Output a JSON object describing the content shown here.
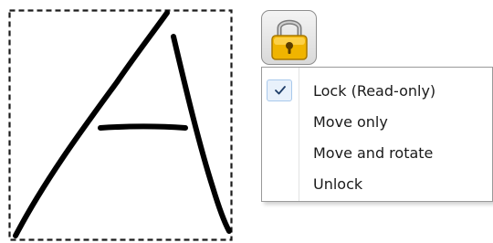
{
  "canvas": {
    "drawing": "handwritten-letter-A",
    "selection_style": "dashed"
  },
  "lock_button": {
    "icon": "padlock-icon",
    "accent_color": "#f0b400"
  },
  "menu": {
    "items": [
      {
        "label": "Lock (Read-only)",
        "checked": true
      },
      {
        "label": "Move only",
        "checked": false
      },
      {
        "label": "Move and rotate",
        "checked": false
      },
      {
        "label": "Unlock",
        "checked": false
      }
    ]
  }
}
